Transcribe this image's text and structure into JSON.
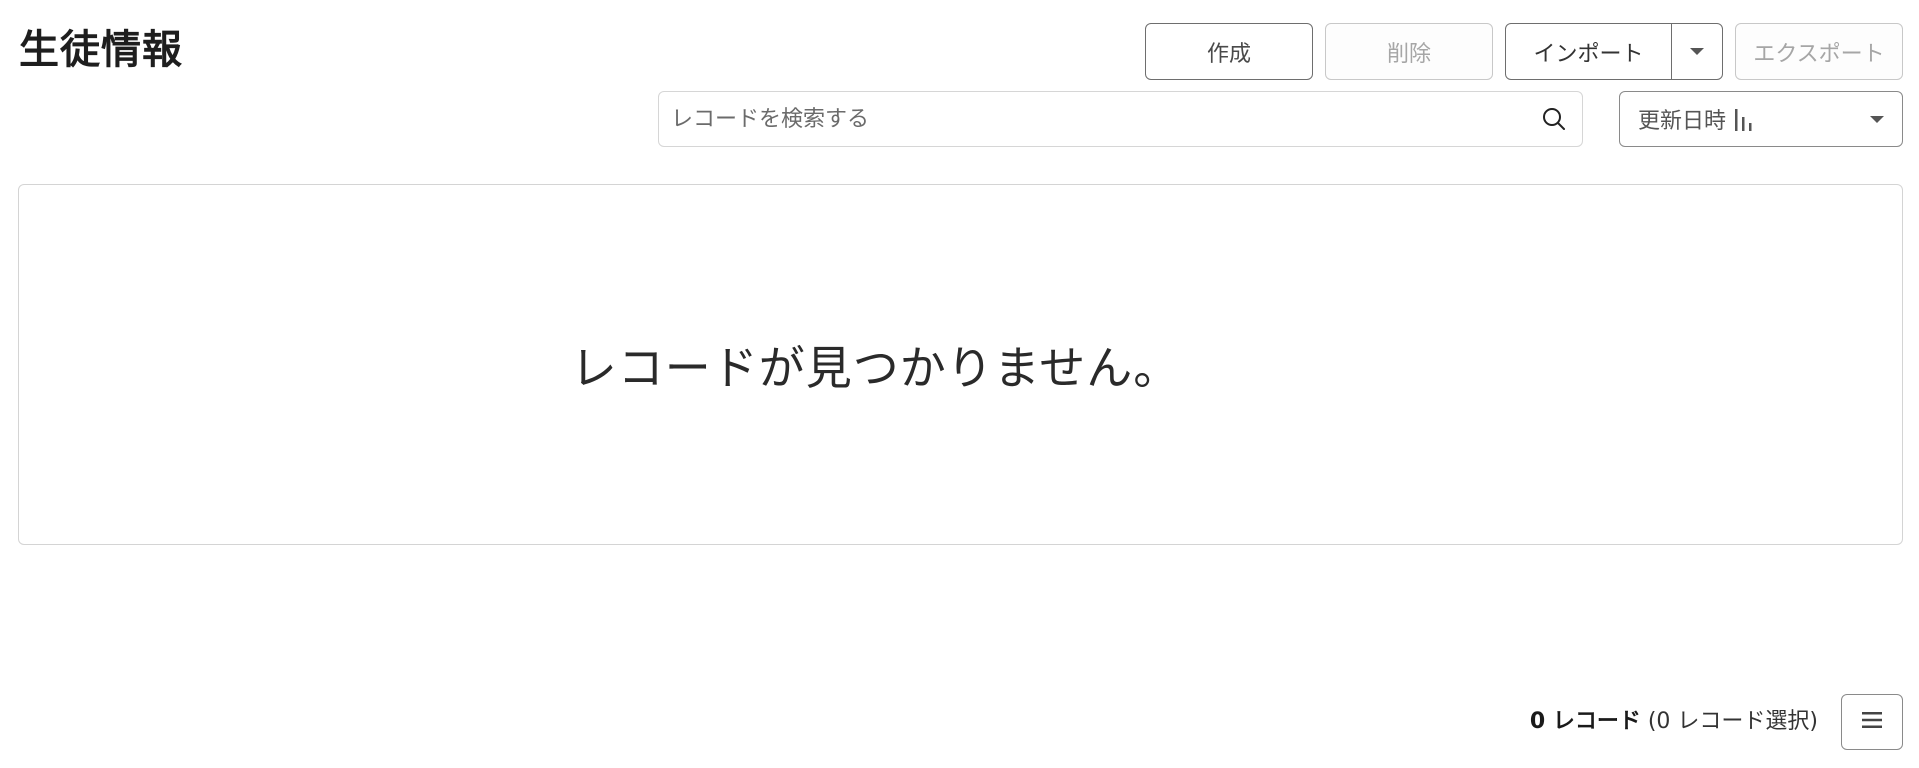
{
  "header": {
    "title": "生徒情報"
  },
  "toolbar": {
    "create_label": "作成",
    "delete_label": "削除",
    "import_label": "インポート",
    "export_label": "エクスポート"
  },
  "search": {
    "placeholder": "レコードを検索する",
    "value": ""
  },
  "sort": {
    "selected": "更新日時"
  },
  "results": {
    "empty_message": "レコードが見つかりません。"
  },
  "footer": {
    "record_count": "0 レコード",
    "selected_count": "(0 レコード選択)"
  },
  "icons": {
    "search": "search-icon",
    "sort": "sort-descending-icon",
    "dropdown": "caret-down-icon",
    "menu": "hamburger-menu-icon"
  },
  "colors": {
    "border_active": "#6e6e6e",
    "border_disabled": "#c8c8c8",
    "text_disabled": "#a6a6a6",
    "panel_border": "#d4d4d4"
  }
}
